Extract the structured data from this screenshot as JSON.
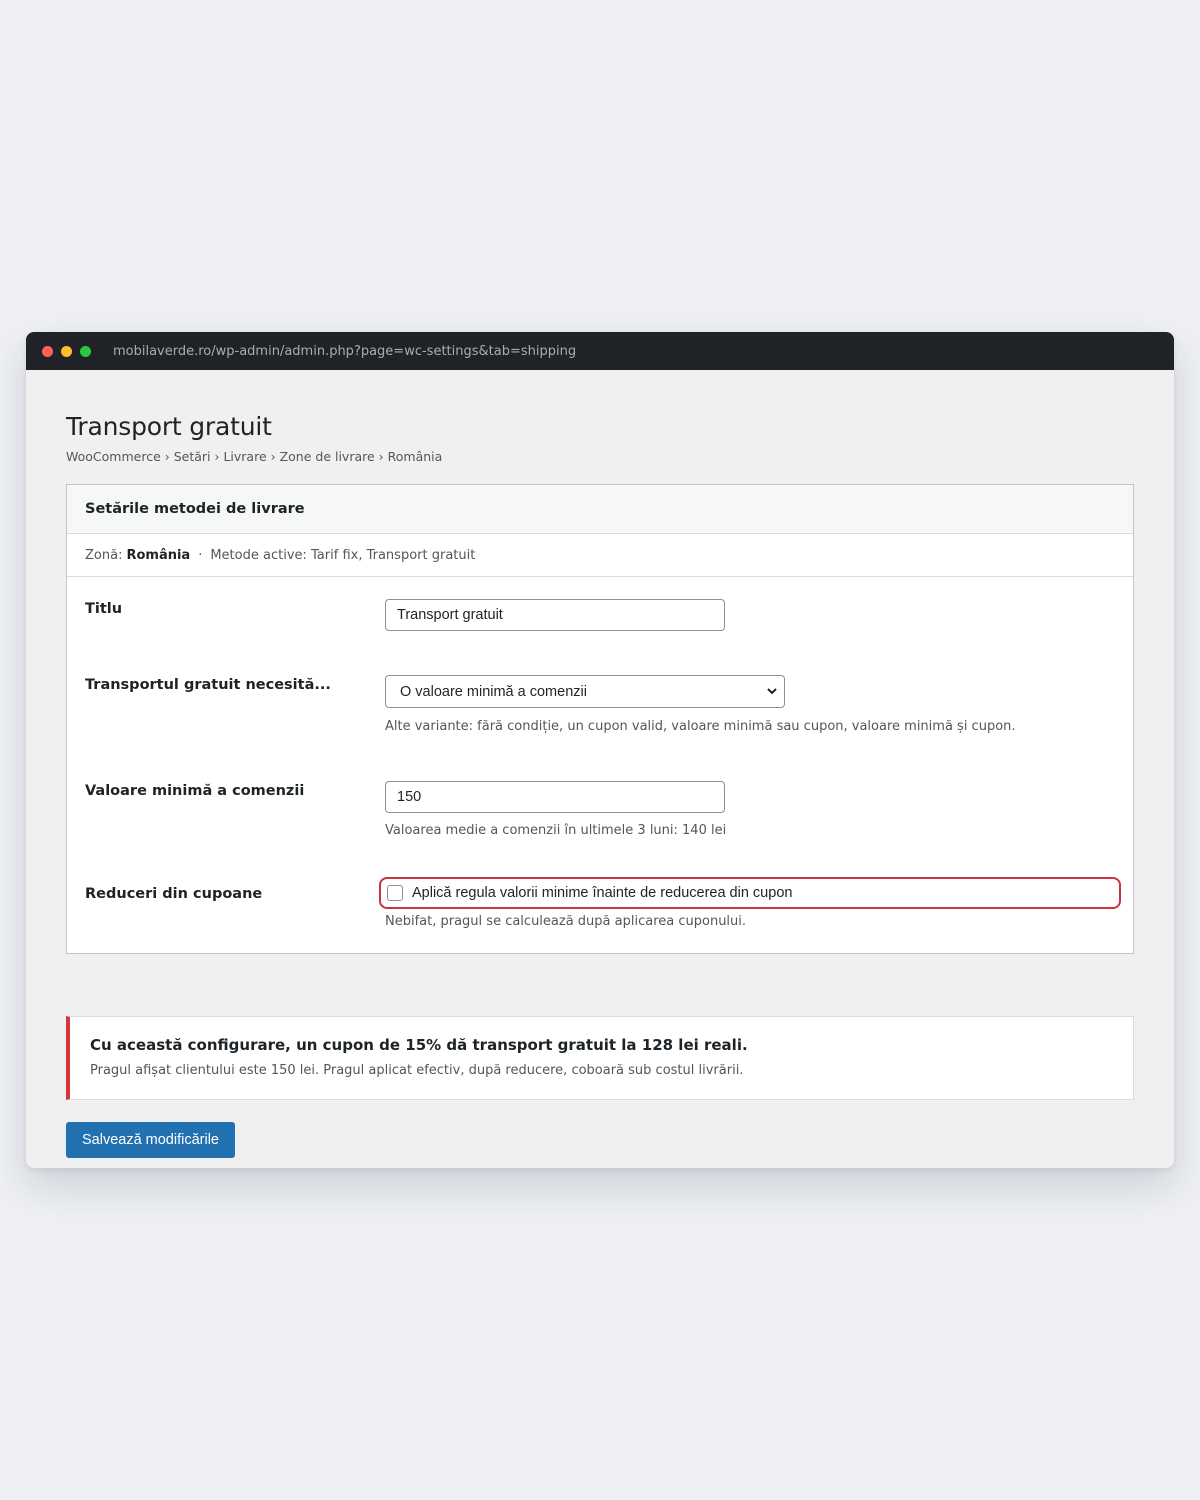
{
  "browser": {
    "url": "mobilaverde.ro/wp-admin/admin.php?page=wc-settings&tab=shipping"
  },
  "page": {
    "title": "Transport gratuit",
    "breadcrumb": "WooCommerce › Setări › Livrare › Zone de livrare › România"
  },
  "card": {
    "header": "Setările metodei de livrare",
    "zone_label": "Zonă:",
    "zone_value": "România",
    "zone_separator": "·",
    "active_methods": "Metode active: Tarif fix, Transport gratuit"
  },
  "fields": {
    "title": {
      "label": "Titlu",
      "value": "Transport gratuit"
    },
    "requires": {
      "label": "Transportul gratuit necesită...",
      "selected": "O valoare minimă a comenzii",
      "help": "Alte variante: fără condiție, un cupon valid, valoare minimă sau cupon, valoare minimă și cupon."
    },
    "min_amount": {
      "label": "Valoare minimă a comenzii",
      "value": "150",
      "help": "Valoarea medie a comenzii în ultimele 3 luni: 140 lei"
    },
    "coupons": {
      "label": "Reduceri din cupoane",
      "checkbox_label": "Aplică regula valorii minime înainte de reducerea din cupon",
      "checked": false,
      "help": "Nebifat, pragul se calculează după aplicarea cuponului."
    }
  },
  "notice": {
    "title": "Cu această configurare, un cupon de 15% dă transport gratuit la 128 lei reali.",
    "text": "Pragul afișat clientului este 150 lei. Pragul aplicat efectiv, după reducere, coboară sub costul livrării.",
    "accent_color": "#d63638"
  },
  "actions": {
    "save_label": "Salvează modificările"
  },
  "colors": {
    "primary": "#2271b1",
    "highlight": "#c9353d",
    "titlebar": "#1f2328"
  }
}
